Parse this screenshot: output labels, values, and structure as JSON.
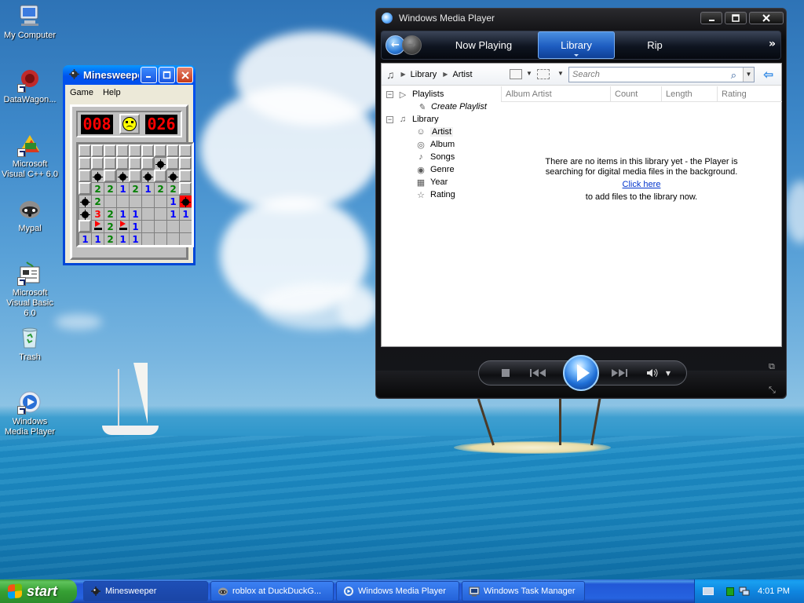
{
  "desktop": {
    "icons": [
      {
        "label": "My Computer",
        "icon": "computer-icon"
      },
      {
        "label": "DataWagon...",
        "icon": "datawagon-icon"
      },
      {
        "label": "Microsoft Visual C++ 6.0",
        "icon": "visual-cpp-icon"
      },
      {
        "label": "Mypal",
        "icon": "mypal-icon"
      },
      {
        "label": "Microsoft Visual Basic 6.0",
        "icon": "visual-basic-icon"
      },
      {
        "label": "Trash",
        "icon": "recycle-bin-icon"
      },
      {
        "label": "Windows Media Player",
        "icon": "media-player-icon"
      }
    ]
  },
  "minesweeper": {
    "title": "Minesweeper",
    "title_display": "Minesweeper",
    "menu": [
      "Game",
      "Help"
    ],
    "mine_counter": "008",
    "timer": "026",
    "face": "sad-face-icon",
    "grid": [
      [
        "c",
        "c",
        "c",
        "c",
        "c",
        "c",
        "c",
        "c",
        "c"
      ],
      [
        "c",
        "c",
        "c",
        "c",
        "c",
        "c",
        "M",
        "c",
        "c"
      ],
      [
        "c",
        "M",
        "c",
        "M",
        "c",
        "M",
        "c",
        "M",
        "c"
      ],
      [
        "c",
        "2",
        "2",
        "1",
        "2",
        "1",
        "2",
        "2",
        "c"
      ],
      [
        "M",
        "2",
        "",
        "",
        "",
        "",
        "",
        "1",
        "X"
      ],
      [
        "M",
        "3",
        "2",
        "1",
        "1",
        "",
        "",
        "1",
        "1"
      ],
      [
        "c",
        "F",
        "2",
        "F",
        "1",
        "",
        "",
        "",
        ""
      ],
      [
        "1",
        "1",
        "2",
        "1",
        "1",
        "",
        "",
        "",
        ""
      ]
    ]
  },
  "wmp": {
    "title": "Windows Media Player",
    "window_buttons": [
      "_",
      "□",
      "X"
    ],
    "tabs": [
      "Now Playing",
      "Library",
      "Rip"
    ],
    "active_tab": "Library",
    "more": "»",
    "breadcrumb": [
      "Library",
      "Artist"
    ],
    "search_placeholder": "Search",
    "tree": {
      "playlists": "Playlists",
      "create_playlist": "Create Playlist",
      "library": "Library",
      "items": [
        "Artist",
        "Album",
        "Songs",
        "Genre",
        "Year",
        "Rating"
      ],
      "selected": "Artist"
    },
    "columns": [
      "Album Artist",
      "Count",
      "Length",
      "Rating"
    ],
    "empty_message_line1": "There are no items in this library yet - the Player is",
    "empty_message_line2": "searching for digital media files in the background.",
    "click_here": "Click here",
    "empty_message_line3": "to add files to the library now."
  },
  "taskbar": {
    "start_label": "start",
    "tasks": [
      {
        "label": "Minesweeper",
        "icon": "minesweeper-icon"
      },
      {
        "label": "roblox at DuckDuckG...",
        "icon": "mypal-icon"
      },
      {
        "label": "Windows Media Player",
        "icon": "media-player-icon"
      },
      {
        "label": "Windows Task Manager",
        "icon": "task-manager-icon"
      }
    ],
    "clock": "4:01 PM"
  }
}
